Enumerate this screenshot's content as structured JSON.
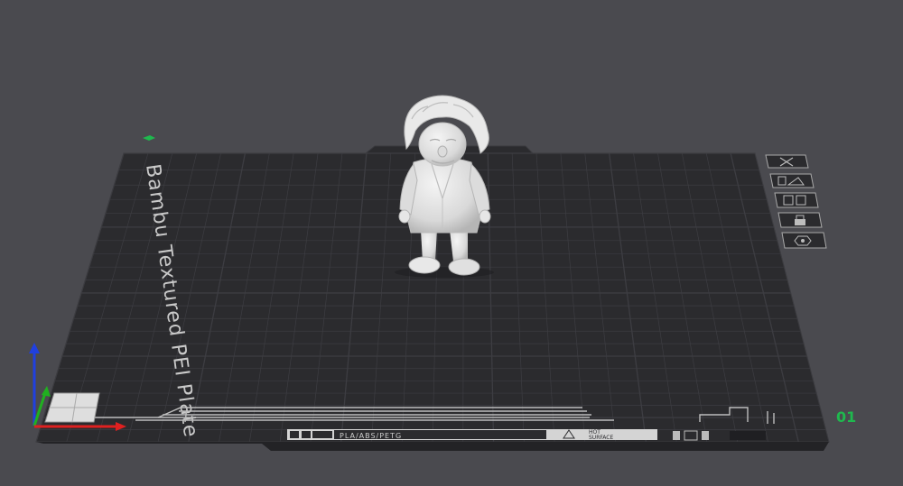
{
  "plate": {
    "name": "Bambu Textured PEI Plate",
    "filament_label": "PLA/ABS/PETG",
    "hot_surface_line1": "HOT",
    "hot_surface_line2": "SURFACE",
    "plate_number": "01"
  },
  "toolbar": {
    "icons": [
      "close-icon",
      "auto-orient-icon",
      "arrange-icon",
      "lock-icon",
      "plate-settings-icon"
    ]
  },
  "colors": {
    "background": "#4a4a4f",
    "plate": "#2b2b2e",
    "grid": "#3d3d42",
    "plate_number": "#1fb84e",
    "axis_x": "#e02020",
    "axis_y": "#20b020",
    "axis_z": "#2040e0",
    "model": "#e6e6e6"
  }
}
